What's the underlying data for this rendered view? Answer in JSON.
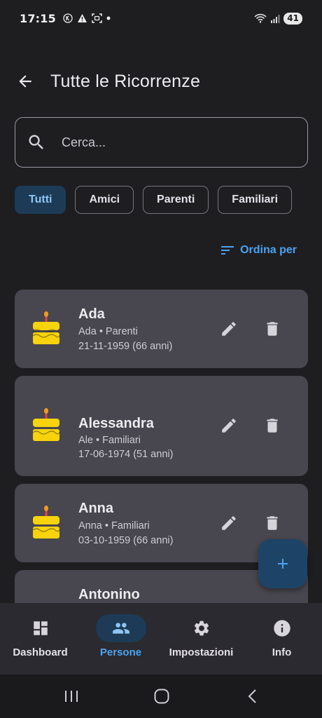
{
  "status_bar": {
    "time": "17:15",
    "battery": "41"
  },
  "header": {
    "title": "Tutte le Ricorrenze"
  },
  "search": {
    "placeholder": "Cerca..."
  },
  "filters": [
    {
      "label": "Tutti",
      "selected": true
    },
    {
      "label": "Amici",
      "selected": false
    },
    {
      "label": "Parenti",
      "selected": false
    },
    {
      "label": "Familiari",
      "selected": false
    }
  ],
  "sort": {
    "label": "Ordina per"
  },
  "people": [
    {
      "name": "Ada",
      "subtitle": "Ada • Parenti",
      "date": "21-11-1959 (66 anni)"
    },
    {
      "name": "Alessandra",
      "subtitle": "Ale • Familiari",
      "date": "17-06-1974 (51 anni)"
    },
    {
      "name": "Anna",
      "subtitle": "Anna • Familiari",
      "date": "03-10-1959 (66 anni)"
    },
    {
      "name": "Antonino",
      "subtitle": "",
      "date": ""
    }
  ],
  "nav": {
    "items": [
      {
        "label": "Dashboard",
        "icon": "dashboard-icon",
        "active": false
      },
      {
        "label": "Persone",
        "icon": "people-icon",
        "active": true
      },
      {
        "label": "Impostazioni",
        "icon": "settings-icon",
        "active": false
      },
      {
        "label": "Info",
        "icon": "info-icon",
        "active": false
      }
    ]
  },
  "colors": {
    "background": "#1e1e21",
    "card": "#48464e",
    "accent": "#4aa3f0",
    "selected_chip": "#1d3b56",
    "cake": "#f6d30a"
  }
}
